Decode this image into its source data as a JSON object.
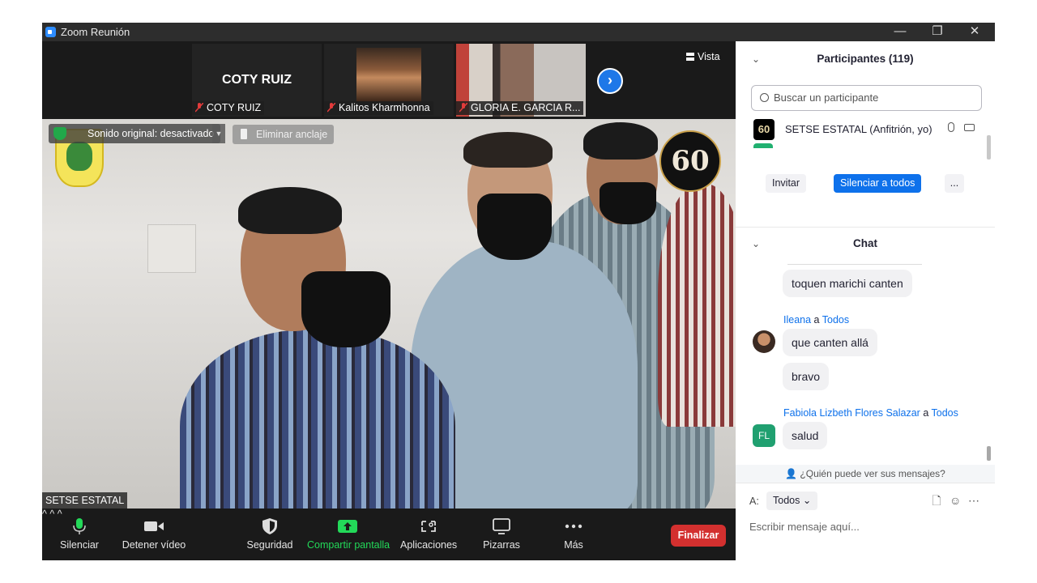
{
  "window": {
    "title": "Zoom Reunión",
    "controls": {
      "minimize": "—",
      "restore": "❐",
      "close": "✕"
    }
  },
  "strip": {
    "tiles": [
      {
        "name": "COTY RUIZ",
        "label": "COTY RUIZ"
      },
      {
        "label": "Kalitos Kharmhonna"
      },
      {
        "label": "GLORIA E. GARCIA R..."
      }
    ],
    "next": "›",
    "view_label": "Vista"
  },
  "main": {
    "sound_pill": "Sonido original: desactivado",
    "unpin": "Eliminar anclaje",
    "speaker": "SETSE ESTATAL",
    "logo_60": "60"
  },
  "toolbar": {
    "mute": "Silenciar",
    "video": "Detener vídeo",
    "security": "Seguridad",
    "share": "Compartir pantalla",
    "apps": "Aplicaciones",
    "whiteboards": "Pizarras",
    "more": "Más",
    "end": "Finalizar",
    "caret": "^"
  },
  "participants": {
    "header": "Participantes (119)",
    "search_placeholder": "Buscar un participante",
    "rows": [
      {
        "avatar": "60",
        "name": "SETSE ESTATAL (Anfitrión, yo)"
      }
    ],
    "invite": "Invitar",
    "mute_all": "Silenciar a todos",
    "more": "..."
  },
  "chat": {
    "header": "Chat",
    "messages": [
      {
        "text": "toquen marichi canten"
      },
      {
        "sender": "Ileana",
        "to": "Todos",
        "text": "que canten allá"
      },
      {
        "text": "bravo"
      },
      {
        "sender": "Fabiola Lizbeth Flores Salazar",
        "to": "Todos",
        "initials": "FL",
        "text": "salud"
      }
    ],
    "to_word": "a",
    "who_sees": "¿Quién puede ver sus mensajes?",
    "to_label": "A:",
    "to_value": "Todos",
    "input_placeholder": "Escribir mensaje aquí..."
  }
}
